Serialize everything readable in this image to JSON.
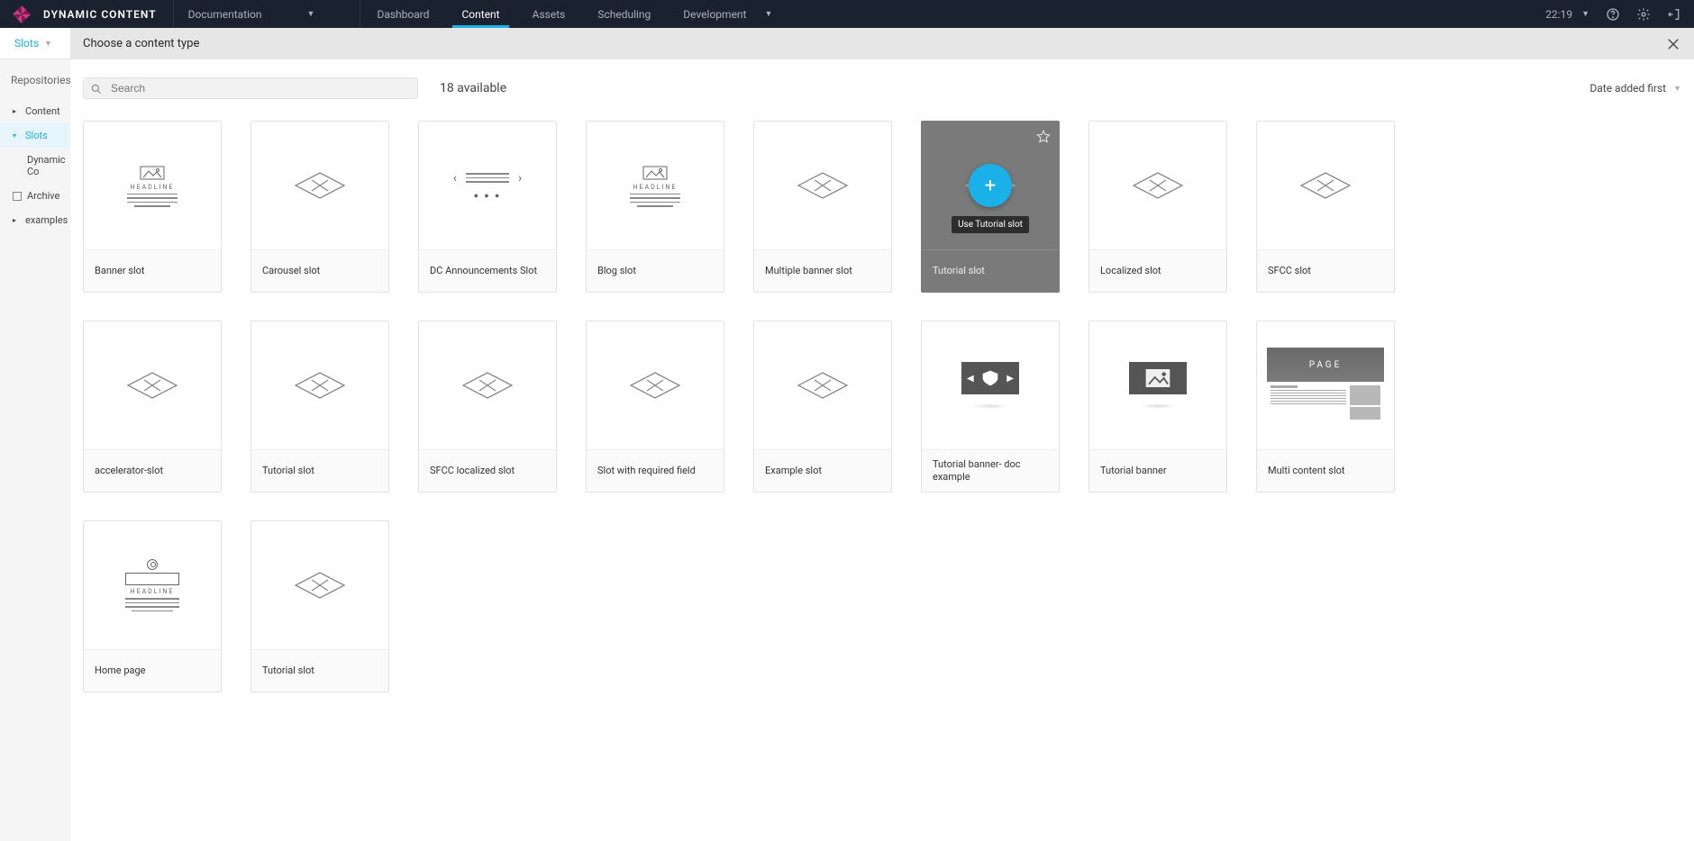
{
  "navbar": {
    "brand": "DYNAMIC CONTENT",
    "doc_label": "Documentation",
    "tabs": [
      "Dashboard",
      "Content",
      "Assets",
      "Scheduling",
      "Development"
    ],
    "active_tab_index": 1,
    "time": "22:19"
  },
  "subbar": {
    "slots_label": "Slots"
  },
  "background": {
    "breadcrumb": "Repositories a",
    "tree": [
      {
        "label": "Content",
        "expanded": false
      },
      {
        "label": "Slots",
        "expanded": true,
        "active": true
      },
      {
        "label": "Dynamic Co",
        "sub": true
      },
      {
        "label": "Archive",
        "archive": true
      },
      {
        "label": "examples",
        "expanded": false
      }
    ]
  },
  "modal": {
    "title": "Choose a content type",
    "search_placeholder": "Search",
    "count_label": "18 available",
    "sort_label": "Date added first",
    "tooltip": "Use Tutorial slot",
    "cards": [
      {
        "title": "Banner slot",
        "thumb": "banner"
      },
      {
        "title": "Carousel slot",
        "thumb": "slot"
      },
      {
        "title": "DC Announcements Slot",
        "thumb": "carousel"
      },
      {
        "title": "Blog slot",
        "thumb": "banner"
      },
      {
        "title": "Multiple banner slot",
        "thumb": "slot"
      },
      {
        "title": "Tutorial slot",
        "thumb": "slot",
        "hovered": true
      },
      {
        "title": "Localized slot",
        "thumb": "slot"
      },
      {
        "title": "SFCC slot",
        "thumb": "slot"
      },
      {
        "title": "accelerator-slot",
        "thumb": "slot"
      },
      {
        "title": "Tutorial slot",
        "thumb": "slot"
      },
      {
        "title": "SFCC localized slot",
        "thumb": "slot"
      },
      {
        "title": "Slot with required field",
        "thumb": "slot"
      },
      {
        "title": "Example slot",
        "thumb": "slot"
      },
      {
        "title": "Tutorial banner- doc example",
        "thumb": "shield"
      },
      {
        "title": "Tutorial banner",
        "thumb": "imgbanner"
      },
      {
        "title": "Multi content slot",
        "thumb": "multicontent",
        "page_label": "PAGE"
      },
      {
        "title": "Home page",
        "thumb": "homepage"
      },
      {
        "title": "Tutorial slot",
        "thumb": "slot"
      }
    ]
  }
}
